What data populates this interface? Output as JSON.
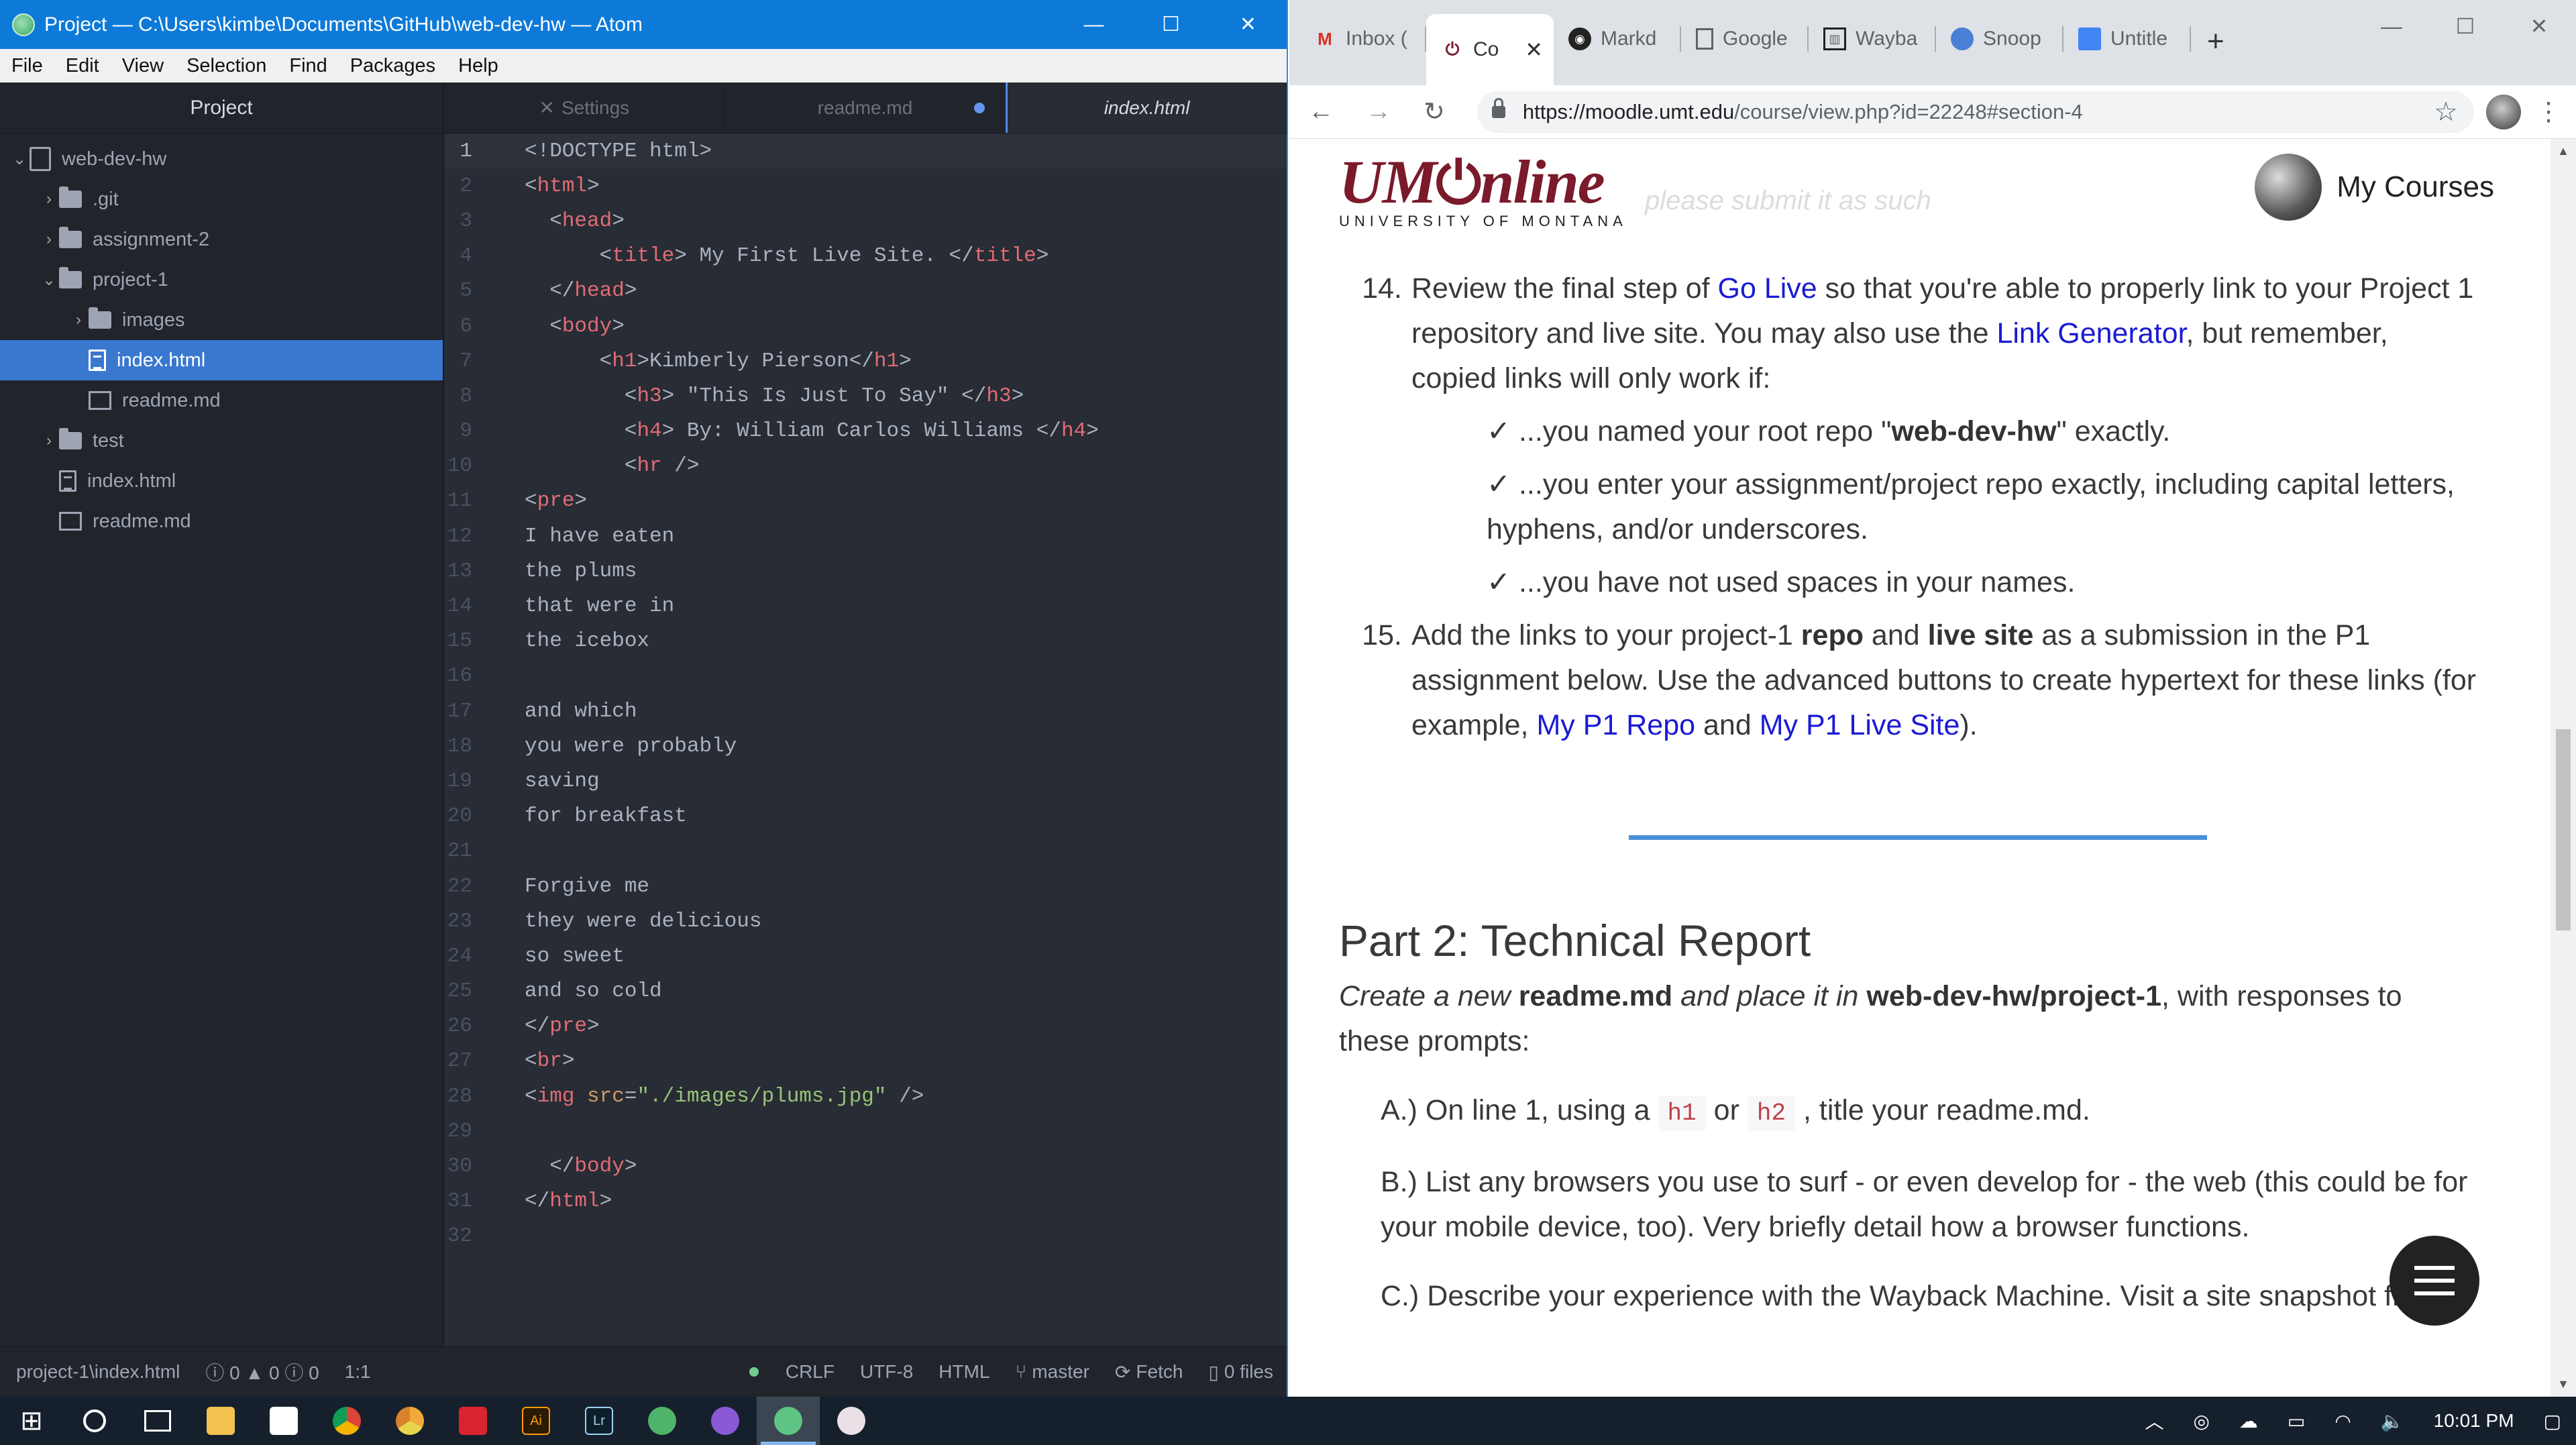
{
  "atom": {
    "title": "Project — C:\\Users\\kimbe\\Documents\\GitHub\\web-dev-hw — Atom",
    "menu": [
      "File",
      "Edit",
      "View",
      "Selection",
      "Find",
      "Packages",
      "Help"
    ],
    "tree": {
      "header": "Project",
      "items": [
        {
          "label": "web-dev-hw",
          "type": "repo",
          "depth": 0,
          "expanded": true
        },
        {
          "label": ".git",
          "type": "folder",
          "depth": 1,
          "expanded": false
        },
        {
          "label": "assignment-2",
          "type": "folder",
          "depth": 1,
          "expanded": false
        },
        {
          "label": "project-1",
          "type": "folder",
          "depth": 1,
          "expanded": true
        },
        {
          "label": "images",
          "type": "folder",
          "depth": 2,
          "expanded": false
        },
        {
          "label": "index.html",
          "type": "file",
          "depth": 2,
          "selected": true
        },
        {
          "label": "readme.md",
          "type": "book",
          "depth": 2
        },
        {
          "label": "test",
          "type": "folder",
          "depth": 1,
          "expanded": false
        },
        {
          "label": "index.html",
          "type": "file",
          "depth": 1
        },
        {
          "label": "readme.md",
          "type": "book",
          "depth": 1
        }
      ]
    },
    "tabs": [
      {
        "label": "Settings",
        "icon": "settings-icon"
      },
      {
        "label": "readme.md",
        "modified": true
      },
      {
        "label": "index.html",
        "active": true
      }
    ],
    "code_lines": [
      [
        [
          "ct",
          "<!DOCTYPE html>"
        ]
      ],
      [
        [
          "ct",
          "<"
        ],
        [
          "tg",
          "html"
        ],
        [
          "ct",
          ">"
        ]
      ],
      [
        [
          "ct",
          "  <"
        ],
        [
          "tg",
          "head"
        ],
        [
          "ct",
          ">"
        ]
      ],
      [
        [
          "ct",
          "      <"
        ],
        [
          "tg",
          "title"
        ],
        [
          "ct",
          "> My First Live Site. </"
        ],
        [
          "tg",
          "title"
        ],
        [
          "ct",
          ">"
        ]
      ],
      [
        [
          "ct",
          "  </"
        ],
        [
          "tg",
          "head"
        ],
        [
          "ct",
          ">"
        ]
      ],
      [
        [
          "ct",
          "  <"
        ],
        [
          "tg",
          "body"
        ],
        [
          "ct",
          ">"
        ]
      ],
      [
        [
          "ct",
          "      <"
        ],
        [
          "tg",
          "h1"
        ],
        [
          "ct",
          ">Kimberly Pierson</"
        ],
        [
          "tg",
          "h1"
        ],
        [
          "ct",
          ">"
        ]
      ],
      [
        [
          "ct",
          "        <"
        ],
        [
          "tg",
          "h3"
        ],
        [
          "ct",
          "> \"This Is Just To Say\" </"
        ],
        [
          "tg",
          "h3"
        ],
        [
          "ct",
          ">"
        ]
      ],
      [
        [
          "ct",
          "        <"
        ],
        [
          "tg",
          "h4"
        ],
        [
          "ct",
          "> By: William Carlos Williams </"
        ],
        [
          "tg",
          "h4"
        ],
        [
          "ct",
          ">"
        ]
      ],
      [
        [
          "ct",
          "        <"
        ],
        [
          "tg",
          "hr"
        ],
        [
          "ct",
          " />"
        ]
      ],
      [
        [
          "ct",
          "<"
        ],
        [
          "tg",
          "pre"
        ],
        [
          "ct",
          ">"
        ]
      ],
      [
        [
          "ct",
          "I have eaten"
        ]
      ],
      [
        [
          "ct",
          "the plums"
        ]
      ],
      [
        [
          "ct",
          "that were in"
        ]
      ],
      [
        [
          "ct",
          "the icebox"
        ]
      ],
      [
        [
          "ct",
          ""
        ]
      ],
      [
        [
          "ct",
          "and which"
        ]
      ],
      [
        [
          "ct",
          "you were probably"
        ]
      ],
      [
        [
          "ct",
          "saving"
        ]
      ],
      [
        [
          "ct",
          "for breakfast"
        ]
      ],
      [
        [
          "ct",
          ""
        ]
      ],
      [
        [
          "ct",
          "Forgive me"
        ]
      ],
      [
        [
          "ct",
          "they were delicious"
        ]
      ],
      [
        [
          "ct",
          "so sweet"
        ]
      ],
      [
        [
          "ct",
          "and so cold"
        ]
      ],
      [
        [
          "ct",
          "</"
        ],
        [
          "tg",
          "pre"
        ],
        [
          "ct",
          ">"
        ]
      ],
      [
        [
          "ct",
          "<"
        ],
        [
          "tg",
          "br"
        ],
        [
          "ct",
          ">"
        ]
      ],
      [
        [
          "ct",
          "<"
        ],
        [
          "tg",
          "img"
        ],
        [
          "ct",
          " "
        ],
        [
          "at",
          "src"
        ],
        [
          "ct",
          "="
        ],
        [
          "st",
          "\"./images/plums.jpg\""
        ],
        [
          "ct",
          " />"
        ]
      ],
      [
        [
          "ct",
          ""
        ]
      ],
      [
        [
          "ct",
          "  </"
        ],
        [
          "tg",
          "body"
        ],
        [
          "ct",
          ">"
        ]
      ],
      [
        [
          "ct",
          "</"
        ],
        [
          "tg",
          "html"
        ],
        [
          "ct",
          ">"
        ]
      ],
      [
        [
          "ct",
          ""
        ]
      ]
    ],
    "status": {
      "path": "project-1\\index.html",
      "diagnostics": "ⓘ 0 ▲ 0 ⓘ 0",
      "cursor": "1:1",
      "line_ending": "CRLF",
      "encoding": "UTF-8",
      "grammar": "HTML",
      "branch": "master",
      "fetch": "Fetch",
      "files": "0 files"
    }
  },
  "chrome": {
    "tabs": [
      {
        "label": "Inbox (",
        "icon": "gmail-icon"
      },
      {
        "label": "Co",
        "icon": "moodle-power-icon",
        "active": true
      },
      {
        "label": "Markd",
        "icon": "github-icon"
      },
      {
        "label": "Google",
        "icon": "doc-icon"
      },
      {
        "label": "Wayba",
        "icon": "wayback-icon"
      },
      {
        "label": "Snoop",
        "icon": "snoop-icon"
      },
      {
        "label": "Untitle",
        "icon": "gdoc-icon"
      }
    ],
    "url_host": "https://moodle.umt.edu",
    "url_path": "/course/view.php?id=22248#section-4",
    "logo_text": "UM",
    "logo_text2": "nline",
    "logo_sub": "UNIVERSITY OF MONTANA",
    "my_courses": "My Courses",
    "ghost_text": "please submit it as such",
    "item14": {
      "num": "14.",
      "t1": "Review the final step of ",
      "l1": "Go Live",
      "t2": " so that you're able to properly link to your Project 1 repository and live site. You may also use the ",
      "l2": "Link Generator",
      "t3": ", but remember, copied links will only work if:"
    },
    "checks": {
      "c1a": "✓ ...you named your root repo \"",
      "c1b": "web-dev-hw",
      "c1c": "\" exactly.",
      "c2": "✓ ...you enter your assignment/project repo exactly, including capital letters, hyphens, and/or underscores.",
      "c3": "✓ ...you have not used spaces in your names."
    },
    "item15": {
      "num": "15.",
      "t1": "Add the links to your project-1 ",
      "b1": "repo",
      "t2": " and ",
      "b2": "live site",
      "t3": " as a submission in the P1 assignment below. Use the advanced buttons to create hypertext for these links (for example, ",
      "l1": "My P1 Repo",
      "t4": " and ",
      "l2": "My P1 Live Site",
      "t5": ")."
    },
    "part2": {
      "heading": "Part 2: Technical Report",
      "i1": "Create a new ",
      "b1": "readme.md",
      "i2": " and place it in ",
      "b2": "web-dev-hw/project-1",
      "t1": ", with responses to these prompts:",
      "a1": "A.) On line 1, using a ",
      "code1": "h1",
      "a2": " or ",
      "code2": "h2",
      "a3": " , title your readme.md.",
      "b": "B.) List any browsers you use to surf - or even develop for - the web (this could be for your mobile device, too). Very briefly detail how a browser functions.",
      "c": "C.) Describe your experience with the Wayback Machine. Visit a site snapshot from"
    }
  },
  "taskbar": {
    "time": "10:01 PM"
  },
  "colors": {
    "accent_blue": "#0d7ad9",
    "tree_selected": "#3a78d0",
    "um_maroon": "#7a1a2b",
    "link_blue": "#1a1ad4"
  }
}
